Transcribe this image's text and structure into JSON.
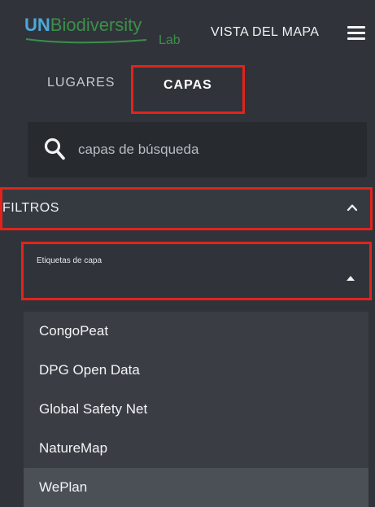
{
  "header": {
    "logo_main_un": "UN",
    "logo_main_rest": "Biodiversity",
    "logo_sub": "Lab",
    "map_view_label": "VISTA DEL MAPA",
    "menu_icon": "hamburger-menu-icon"
  },
  "tabs": [
    {
      "label": "LUGARES",
      "active": false
    },
    {
      "label": "CAPAS",
      "active": true
    }
  ],
  "search": {
    "icon": "search-icon",
    "placeholder": "capas de búsqueda",
    "value": ""
  },
  "filters": {
    "label": "FILTROS",
    "icon": "chevron-up-icon",
    "expanded": true
  },
  "layer_tags": {
    "label": "Etiquetas de capa",
    "icon": "caret-up-icon",
    "options": [
      "CongoPeat",
      "DPG Open Data",
      "Global Safety Net",
      "NatureMap",
      "WePlan"
    ],
    "highlighted": "WePlan"
  },
  "colors": {
    "background": "#30343a",
    "search_background": "#272a2f",
    "dropdown_background": "#3a3e44",
    "highlight_background": "#4b4f56",
    "annotation_red": "#e3231b",
    "logo_blue": "#4fa6d8",
    "logo_green": "#3c8f4a"
  }
}
